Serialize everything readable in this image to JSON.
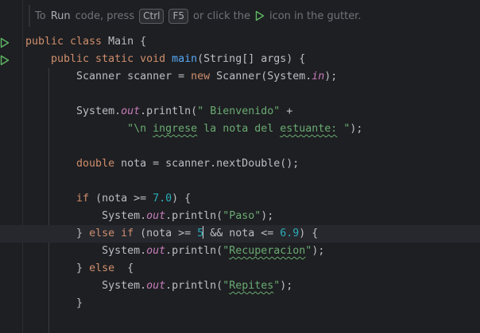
{
  "hint": {
    "prefix": "To",
    "run_word": "Run",
    "middle": "code, press",
    "key1": "Ctrl",
    "key2": "F5",
    "suffix_a": "or click the",
    "suffix_b": "icon in the gutter."
  },
  "code": {
    "l1_a": "public class ",
    "l1_b": "Main {",
    "l2_a": "    public static void ",
    "l2_fn": "main",
    "l2_b": "(String[] args) {",
    "l3_a": "        Scanner scanner = ",
    "l3_kw": "new",
    "l3_b": " Scanner(System.",
    "l3_in": "in",
    "l3_c": ");",
    "l5_a": "        System.",
    "l5_out": "out",
    "l5_b": ".println(",
    "l5_str": "\" Bienvenido\"",
    "l5_c": " +",
    "l6_pre": "                ",
    "l6_s1": "\"\\n ",
    "l6_s2": "ingrese",
    "l6_s3": " la nota del ",
    "l6_s4": "estuante:",
    "l6_s5": " \"",
    "l6_end": ");",
    "l8_kw": "        double",
    "l8_b": " nota = scanner.nextDouble();",
    "l10_kw": "        if",
    "l10_b": " (nota >= ",
    "l10_num": "7.0",
    "l10_c": ") {",
    "l11_a": "            System.",
    "l11_out": "out",
    "l11_b": ".println(",
    "l11_str": "\"Paso\"",
    "l11_c": ");",
    "l12_a": "        } ",
    "l12_kw1": "else if",
    "l12_b": " (nota >= ",
    "l12_num1": "5",
    "l12_c": " && nota <= ",
    "l12_num2": "6.9",
    "l12_d": ") {",
    "l13_a": "            System.",
    "l13_out": "out",
    "l13_b": ".println(",
    "l13_q1": "\"",
    "l13_word": "Recuperacion",
    "l13_q2": "\"",
    "l13_c": ");",
    "l14_a": "        } ",
    "l14_kw": "else",
    "l14_b": "  {",
    "l15_a": "            System.",
    "l15_out": "out",
    "l15_b": ".println(",
    "l15_q1": "\"",
    "l15_word": "Repites",
    "l15_q2": "\"",
    "l15_c": ");",
    "l16": "        }"
  },
  "colors": {
    "background": "#1e1f22",
    "keyword": "#cf8e6d",
    "function": "#56a8f5",
    "string": "#6aab73",
    "number": "#2aacb8",
    "static_field": "#c77dbb",
    "run_icon": "#5fb865",
    "bulb": "#f2c55c"
  }
}
